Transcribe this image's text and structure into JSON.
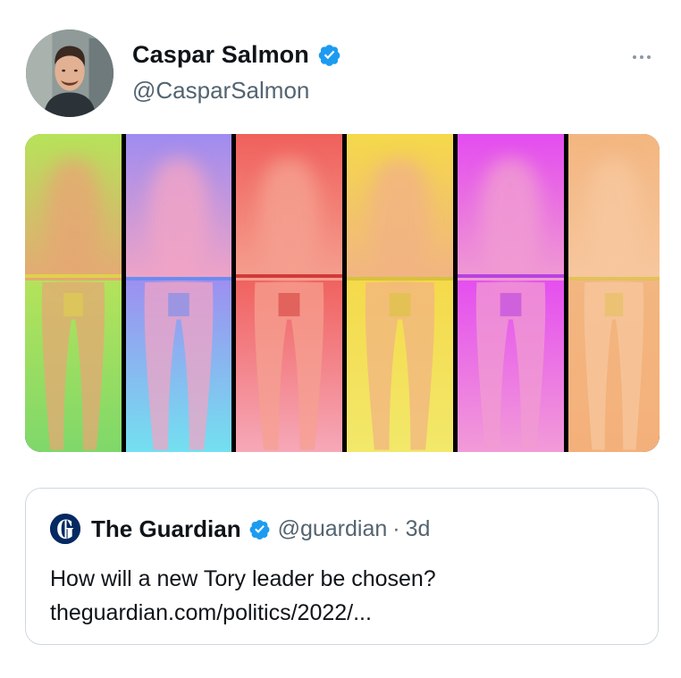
{
  "tweet": {
    "author": {
      "display_name": "Caspar Salmon",
      "handle": "@CasparSalmon",
      "verified": true,
      "verified_icon": "verified-badge-icon",
      "avatar": "avatar-photo"
    },
    "more_icon": "more-options-icon",
    "media": {
      "panels": [
        {
          "top": "#b6e35a",
          "accent": "#e5a874",
          "bar": "#e0d14a",
          "bottom": "#7fd86a"
        },
        {
          "top": "#9f8cf0",
          "accent": "#f0a4c6",
          "bar": "#6a8cf0",
          "bottom": "#73e0f0"
        },
        {
          "top": "#f0605c",
          "accent": "#f5a090",
          "bar": "#d23a3a",
          "bottom": "#f6a8b8"
        },
        {
          "top": "#f5d94a",
          "accent": "#f1b483",
          "bar": "#d7c23a",
          "bottom": "#f2e86a"
        },
        {
          "top": "#e44cf0",
          "accent": "#f09bd2",
          "bar": "#b642e0",
          "bottom": "#f29bd8"
        },
        {
          "top": "#f3b680",
          "accent": "#f7c79e",
          "bar": "#e2c15a",
          "bottom": "#f4b07a"
        }
      ]
    },
    "quoted": {
      "logo_icon": "guardian-logo-icon",
      "name": "The Guardian",
      "handle": "@guardian",
      "separator": "·",
      "time": "3d",
      "text_line1": "How will a new Tory leader be chosen?",
      "text_line2": "theguardian.com/politics/2022/..."
    }
  },
  "colors": {
    "verified": "#1d9bf0",
    "secondary_text": "#536471",
    "border": "#cfd9de",
    "guardian_blue": "#052962"
  }
}
